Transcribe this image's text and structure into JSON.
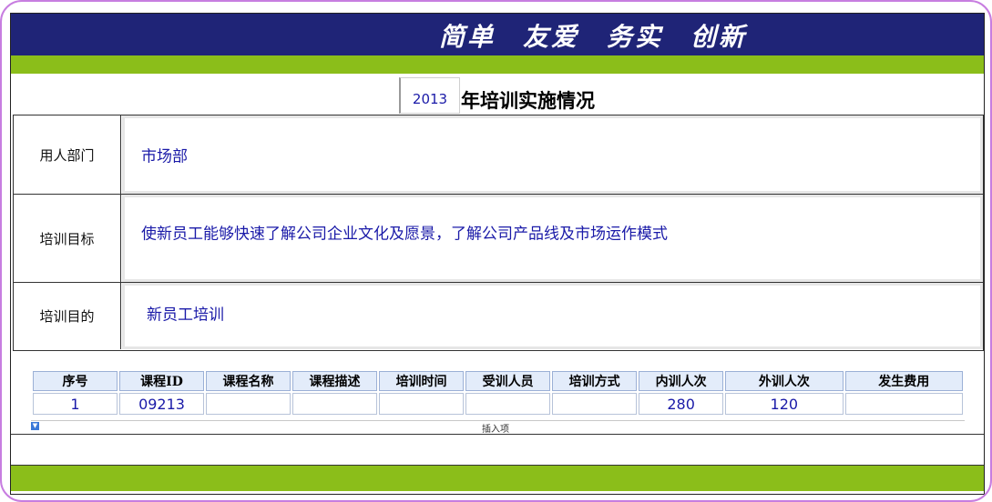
{
  "banner": {
    "slogans": [
      "简单",
      "友爱",
      "务实",
      "创新"
    ]
  },
  "title": {
    "year": "2013",
    "text": "年培训实施情况"
  },
  "info_rows": [
    {
      "label": "用人部门",
      "value": "市场部"
    },
    {
      "label": "培训目标",
      "value": "使新员工能够快速了解公司企业文化及愿景，了解公司产品线及市场运作模式"
    },
    {
      "label": "培训目的",
      "value": "新员工培训"
    }
  ],
  "table": {
    "headers": [
      "序号",
      "课程ID",
      "课程名称",
      "课程描述",
      "培训时间",
      "受训人员",
      "培训方式",
      "内训人次",
      "外训人次",
      "发生费用"
    ],
    "rows": [
      [
        "1",
        "09213",
        "",
        "",
        "",
        "",
        "",
        "280",
        "120",
        ""
      ]
    ]
  },
  "insert_label": "插入项",
  "colors": {
    "banner": "#1f2477",
    "green_bar": "#8bbe1a",
    "value_text": "#1a1aa8",
    "frame": "#c77de0"
  }
}
